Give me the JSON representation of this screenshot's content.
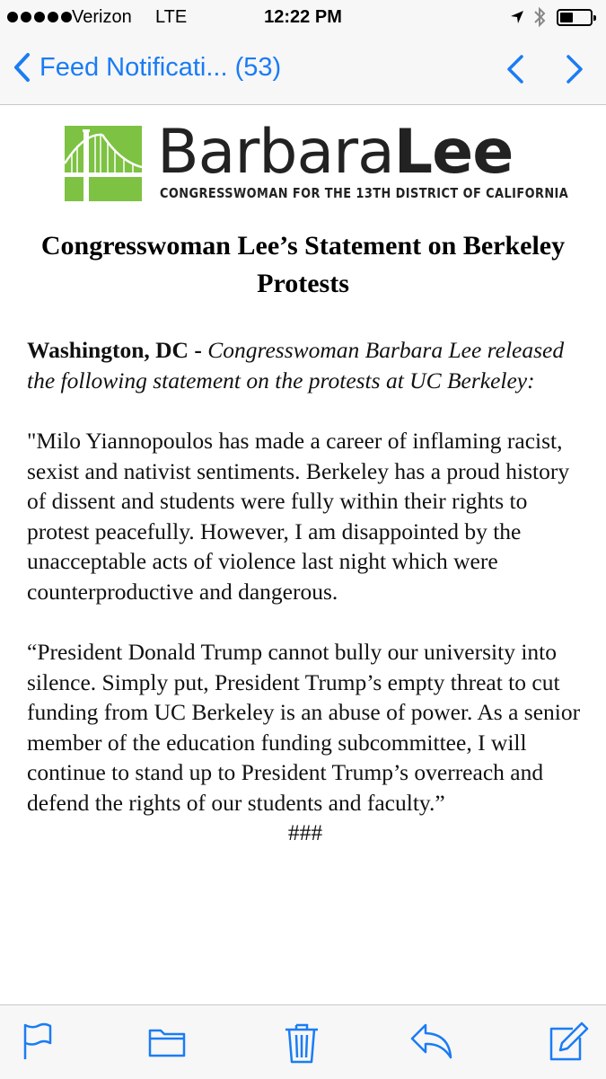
{
  "status_bar": {
    "carrier": "Verizon",
    "network": "LTE",
    "time": "12:22 PM",
    "signal_bars_filled": 5,
    "battery_level": 0.45
  },
  "nav": {
    "back_label": "Feed Notificati... (53)",
    "prev_icon": "chevron-up-icon",
    "next_icon": "chevron-down-icon",
    "accent_color": "#1a7cf5"
  },
  "logo": {
    "first_name": "Barbara",
    "last_name": "Lee",
    "tagline": "CONGRESSWOMAN FOR THE 13TH DISTRICT OF CALIFORNIA",
    "brand_color": "#7dc242"
  },
  "article": {
    "title": "Congresswoman Lee’s Statement on Berkeley Protests",
    "dateline": "Washington, DC - ",
    "lede": "Congresswoman Barbara Lee released the following statement on the protests at UC Berkeley:",
    "paragraph_1": "\"Milo Yiannopoulos has made a career of inflaming racist, sexist and nativist sentiments. Berkeley has a proud history of dissent and students were fully within their rights to protest peacefully. However, I am disappointed by the unacceptable acts of violence last night which were counterproductive and dangerous.",
    "paragraph_2": "“President Donald Trump cannot bully our university into silence. Simply put, President Trump’s empty threat to cut funding from UC Berkeley is an abuse of power. As a senior member of the education funding subcommittee, I will continue to stand up to President Trump’s overreach and defend the rights of our students and faculty.”",
    "end_mark": "###"
  },
  "toolbar": {
    "icons": [
      "flag-icon",
      "folder-icon",
      "trash-icon",
      "reply-icon",
      "compose-icon"
    ]
  }
}
